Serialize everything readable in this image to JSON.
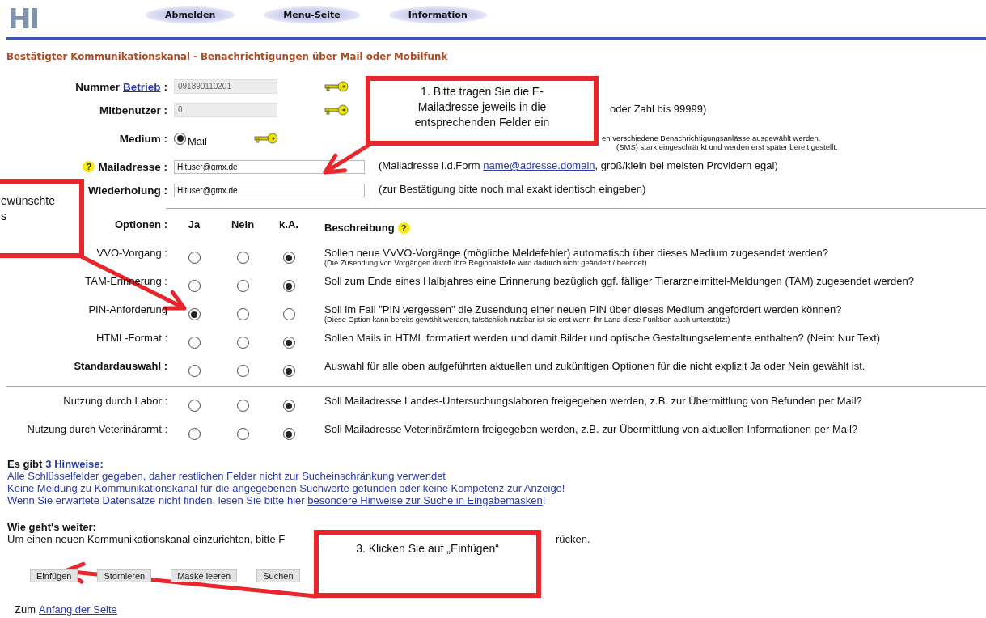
{
  "header": {
    "logo": "HI",
    "nav": [
      "Abmelden",
      "Menu-Seite",
      "Information"
    ]
  },
  "title": "Bestätigter Kommunikationskanal - Benachrichtigungen über Mail oder Mobilfunk",
  "fields": [
    {
      "kind": "readonly",
      "label": "Nummer",
      "link": "Betrieb",
      "label_after": ":",
      "value": "091890110201",
      "key": true
    },
    {
      "kind": "readonly",
      "label": "Mitbenutzer :",
      "value": "0",
      "key": true,
      "hint": "oder Zahl bis 99999)"
    },
    {
      "kind": "radio",
      "label": "Medium :",
      "option": "Mail",
      "selected": true,
      "key": true,
      "notes": [
        "en verschiedene Benachrichtigungsanlässe ausgewählt werden.",
        "(SMS) stark eingeschränkt und werden erst später bereit gestellt."
      ]
    },
    {
      "kind": "input",
      "label": "Mailadresse :",
      "help": "?",
      "value": "Hituser@gmx.de",
      "hint_before": "(Mailadresse i.d.Form",
      "hint_link": "name@adresse.domain",
      "hint_after": ", groß/klein bei meisten Providern egal)"
    },
    {
      "kind": "input",
      "label": "Wiederholung :",
      "value": "Hituser@gmx.de",
      "hint_before": "(zur Bestätigung bitte noch mal exakt identisch eingeben)"
    }
  ],
  "options": {
    "columns": [
      "Optionen :",
      "Ja",
      "Nein",
      "k.A.",
      "Beschreibung"
    ],
    "help": "?",
    "groups": [
      [
        {
          "label": "VVO-Vorgang :",
          "bold": false,
          "choices": [
            {
              "selected": false
            },
            {
              "selected": false
            },
            {
              "selected": true
            }
          ],
          "description": "Sollen neue VVVO-Vorgänge (mögliche Meldefehler) automatisch über dieses Medium zugesendet werden?",
          "note": "(Die Zusendung von Vorgängen durch Ihre Regionalstelle wird dadurch nicht geändert / beendet)"
        },
        {
          "label": "TAM-Erinnerung :",
          "bold": false,
          "choices": [
            {
              "selected": false
            },
            {
              "selected": false
            },
            {
              "selected": true
            }
          ],
          "description": "Soll zum Ende eines Halbjahres eine Erinnerung bezüglich ggf. fälliger Tierarzneimittel-Meldungen (TAM) zugesendet werden?"
        },
        {
          "label": "PIN-Anforderung",
          "bold": false,
          "choices": [
            {
              "selected": true
            },
            {
              "selected": false
            },
            {
              "selected": false
            }
          ],
          "description": "Soll im Fall \"PIN vergessen\" die Zusendung einer neuen PIN über dieses Medium angefordert werden können?",
          "note": "(Diese Option kann bereits gewählt werden, tatsächlich nutzbar ist sie erst wenn Ihr Land diese Funktion auch unterstützt)"
        },
        {
          "label": "HTML-Format :",
          "bold": false,
          "choices": [
            {
              "selected": false
            },
            {
              "selected": false
            },
            {
              "selected": true
            }
          ],
          "description": "Sollen Mails in HTML formatiert werden und damit Bilder und optische Gestaltungselemente enthalten? (Nein: Nur Text)"
        },
        {
          "label": "Standardauswahl :",
          "bold": true,
          "choices": [
            {
              "selected": false
            },
            {
              "selected": false
            },
            {
              "selected": true
            }
          ],
          "description": "Auswahl für alle oben aufgeführten aktuellen und zukünftigen Optionen für die nicht explizit Ja oder Nein gewählt ist."
        }
      ],
      [
        {
          "label": "Nutzung durch Labor :",
          "bold": false,
          "choices": [
            {
              "selected": false
            },
            {
              "selected": false
            },
            {
              "selected": true
            }
          ],
          "description": "Soll Mailadresse Landes-Untersuchungslaboren freigegeben werden, z.B. zur Übermittlung von Befunden per Mail?"
        },
        {
          "label": "Nutzung durch Veterinärarmt :",
          "bold": false,
          "choices": [
            {
              "selected": false
            },
            {
              "selected": false
            },
            {
              "selected": true
            }
          ],
          "description": "Soll Mailadresse Veterinärämtern freigegeben werden, z.B. zur Übermittlung von aktuellen Informationen per Mail?"
        }
      ]
    ]
  },
  "notices": {
    "heading": "Es gibt",
    "count": "3 Hinweise:",
    "lines": [
      {
        "text": "Alle Schlüsselfelder gegeben, daher restlichen Felder nicht zur Sucheinschränkung verwendet"
      },
      {
        "text": "Keine Meldung zu Kommunikationskanal für die angegebenen Suchwerte gefunden oder keine Kompetenz zur Anzeige!"
      },
      {
        "text": "Wenn Sie erwartete Datensätze nicht finden, lesen Sie bitte hier",
        "link": "besondere Hinweise zur Suche in Eingabemasken",
        "after": "!"
      }
    ]
  },
  "next": {
    "heading": "Wie geht's weiter:",
    "fragments": [
      "Um einen neuen Kommunikationskanal einzurichten, bitte F",
      "rücken."
    ]
  },
  "buttons": [
    "Einfügen",
    "Stornieren",
    "Maske leeren",
    "Suchen"
  ],
  "footer": {
    "text": "Zum",
    "link": "Anfang der Seite"
  },
  "annotations": [
    {
      "lines": [
        "1. Bitte tragen Sie die E-",
        "Mailadresse jeweils in die",
        "entsprechenden Felder ein"
      ]
    },
    {
      "lines": [
        "ewünschte",
        "s"
      ]
    },
    {
      "lines": [
        "3. Klicken Sie auf „Einfügen“"
      ]
    }
  ]
}
